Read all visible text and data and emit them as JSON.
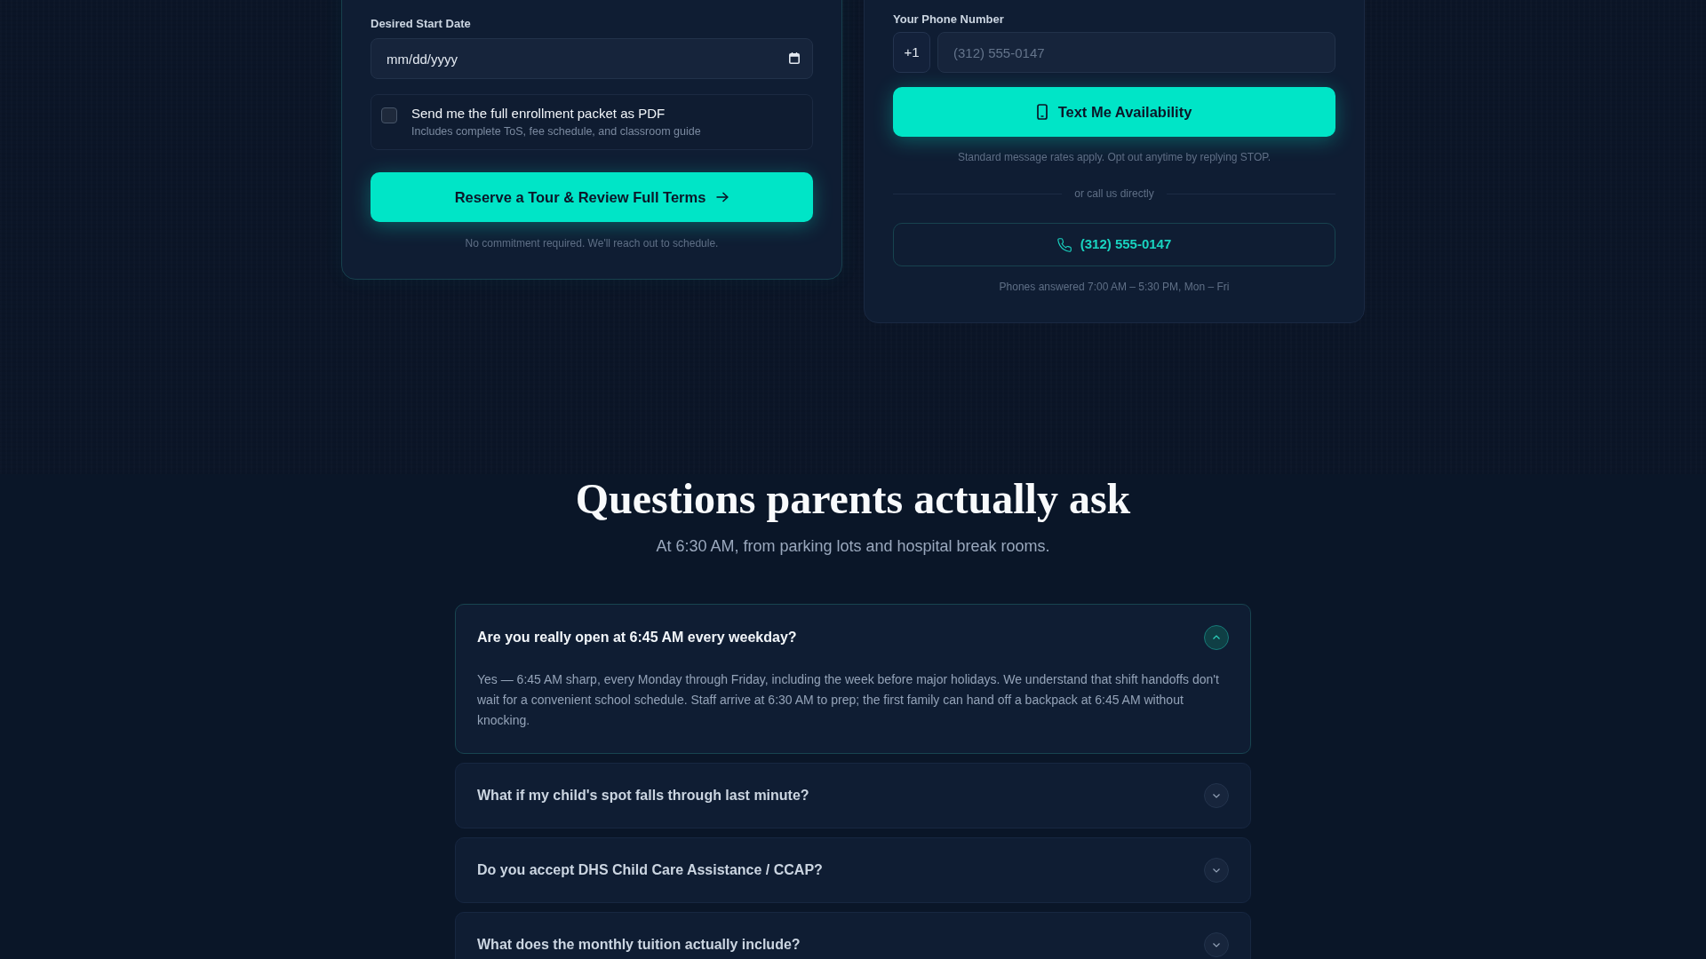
{
  "tour_form": {
    "date_field": {
      "label": "Desired Start Date",
      "placeholder": "mm/dd/yyyy"
    },
    "pdf_option": {
      "label": "Send me the full enrollment packet as PDF",
      "description": "Includes complete ToS, fee schedule, and classroom guide",
      "checked": false
    },
    "submit_button": "Reserve a Tour & Review Full Terms",
    "note": "No commitment required. We'll reach out to schedule."
  },
  "text_form": {
    "phone_field": {
      "label": "Your Phone Number",
      "country_code": "+1",
      "placeholder": "(312) 555-0147"
    },
    "submit_button": "Text Me Availability",
    "note": "Standard message rates apply. Opt out anytime by replying STOP.",
    "divider": "or call us directly",
    "call_button": "(312) 555-0147",
    "hours_note": "Phones answered 7:00 AM – 5:30 PM, Mon – Fri"
  },
  "faq": {
    "title": "Questions parents actually ask",
    "subtitle": "At 6:30 AM, from parking lots and hospital break rooms.",
    "items": [
      {
        "question": "Are you really open at 6:45 AM every weekday?",
        "answer": "Yes — 6:45 AM sharp, every Monday through Friday, including the week before major holidays. We understand that shift handoffs don't wait for a convenient school schedule. Staff arrive at 6:30 AM to prep; the first family can hand off a backpack at 6:45 AM without knocking.",
        "expanded": true
      },
      {
        "question": "What if my child's spot falls through last minute?",
        "expanded": false
      },
      {
        "question": "Do you accept DHS Child Care Assistance / CCAP?",
        "expanded": false
      },
      {
        "question": "What does the monthly tuition actually include?",
        "expanded": false
      }
    ]
  }
}
